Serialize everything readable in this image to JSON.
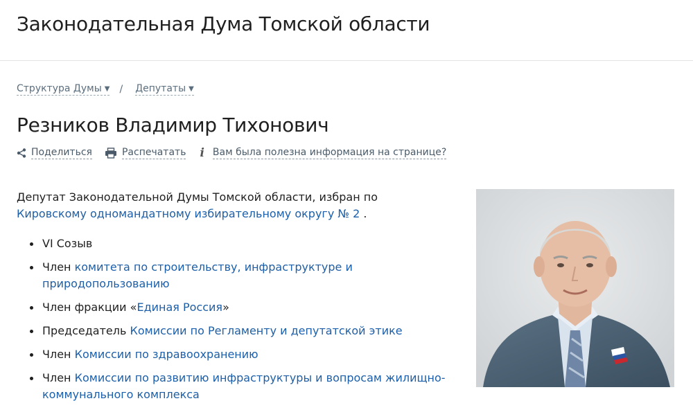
{
  "header": {
    "site_title": "Законодательная Дума Томской области"
  },
  "breadcrumb": [
    {
      "label": "Структура Думы"
    },
    {
      "label": "Депутаты"
    }
  ],
  "breadcrumb_separator": "/",
  "person": {
    "name": "Резников Владимир Тихонович"
  },
  "actions": {
    "share_label": "Поделиться",
    "print_label": "Распечатать",
    "feedback_label": "Вам была полезна информация на странице?"
  },
  "intro": {
    "text": "Депутат Законодательной Думы Томской области, избран по ",
    "district_link": "Кировскому одномандатному избирательному округу № 2",
    "suffix": " ."
  },
  "memberships": [
    {
      "prefix": "VI Созыв",
      "link": "",
      "suffix": ""
    },
    {
      "prefix": "Член ",
      "link": "комитета по строительству, инфраструктуре и природопользованию",
      "suffix": ""
    },
    {
      "prefix": "Член фракции «",
      "link": "Единая Россия",
      "suffix": "»"
    },
    {
      "prefix": "Председатель ",
      "link": "Комиссии по Регламенту и депутатской этике",
      "suffix": ""
    },
    {
      "prefix": "Член ",
      "link": "Комиссии по здравоохранению",
      "suffix": ""
    },
    {
      "prefix": "Член ",
      "link": "Комиссии по развитию инфраструктуры и вопросам жилищно-коммунального комплекса",
      "suffix": ""
    }
  ],
  "colors": {
    "link": "#1c5fa8",
    "text": "#1f1f1f",
    "muted": "#5b6e7e"
  },
  "icons": {
    "share": "share-icon",
    "print": "printer-icon",
    "info": "info-icon"
  }
}
